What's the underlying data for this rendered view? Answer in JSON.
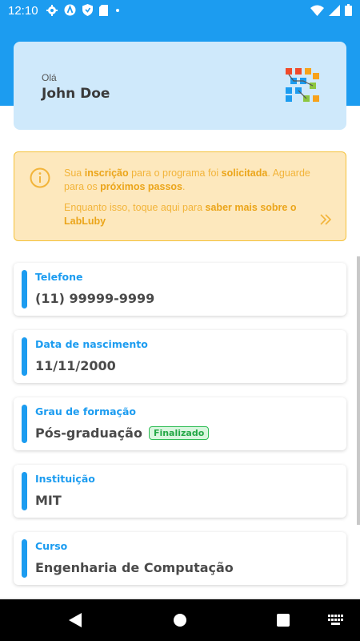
{
  "status_bar": {
    "time": "12:10",
    "icons_left": [
      "gear-icon",
      "a-icon",
      "shield-icon",
      "sd-card-icon",
      "dot-icon"
    ],
    "icons_right": [
      "wifi-icon",
      "signal-icon",
      "battery-icon"
    ]
  },
  "colors": {
    "primary": "#1c9cf0",
    "greeting_bg": "#cfe9fb",
    "notice_bg": "#fde8bd",
    "notice_text": "#f2b43a",
    "badge_green": "#24a846"
  },
  "greeting": {
    "hello": "Olá",
    "name": "John Doe"
  },
  "notice": {
    "line1_a": "Sua ",
    "line1_b": "inscrição",
    "line1_c": " para o programa foi ",
    "line1_d": "solicitada",
    "line1_e": ". Aguarde para os ",
    "line1_f": "próximos passos",
    "line1_g": ".",
    "line2_a": "Enquanto isso, toque aqui para ",
    "line2_b": "saber mais sobre o LabLuby"
  },
  "info": [
    {
      "label": "Telefone",
      "value": "(11) 99999-9999"
    },
    {
      "label": "Data de nascimento",
      "value": "11/11/2000"
    },
    {
      "label": "Grau de formação",
      "value": "Pós-graduação",
      "badge": "Finalizado"
    },
    {
      "label": "Instituição",
      "value": "MIT"
    },
    {
      "label": "Curso",
      "value": "Engenharia de Computação"
    }
  ]
}
